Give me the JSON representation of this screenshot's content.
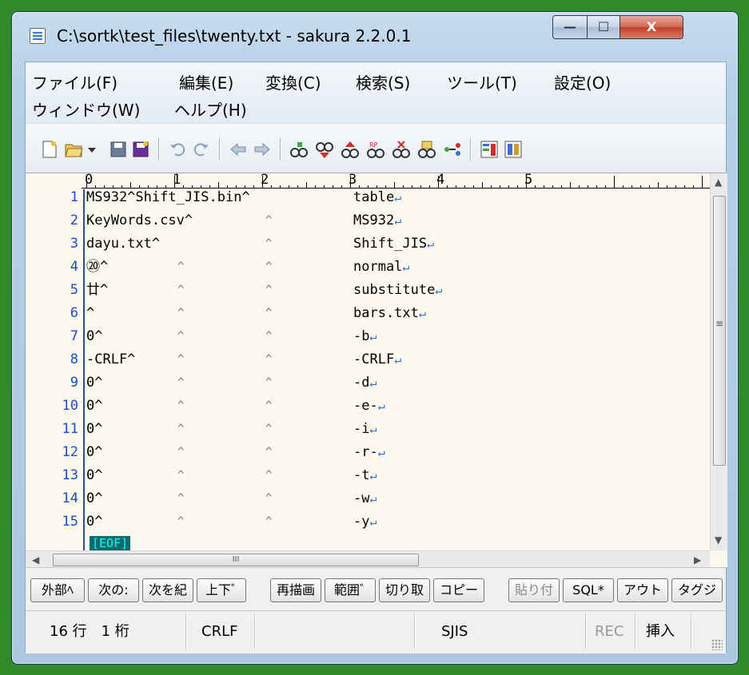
{
  "window": {
    "title": "C:\\sortk\\test_files\\twenty.txt - sakura 2.2.0.1",
    "min_glyph": "—",
    "max_glyph": "☐",
    "close_glyph": "X"
  },
  "menu": {
    "row1": [
      "ファイル(F)",
      "編集(E)",
      "変換(C)",
      "検索(S)",
      "ツール(T)",
      "設定(O)"
    ],
    "row2": [
      "ウィンドウ(W)",
      "ヘルプ(H)"
    ]
  },
  "toolbar": {
    "icons": [
      "new-file-icon",
      "open-file-icon",
      "dropdown-icon",
      "save-icon",
      "save-all-icon",
      "undo-icon",
      "redo-icon",
      "jump-back-icon",
      "jump-forward-icon",
      "find-icon",
      "find-next-icon",
      "find-prev-icon",
      "replace-icon",
      "replace-all-icon",
      "grep-icon",
      "tag-jump-icon",
      "outline-icon",
      "settings-icon"
    ]
  },
  "ruler": [
    "0",
    "1",
    "2",
    "3",
    "4",
    "5"
  ],
  "lines": [
    {
      "num": "1",
      "c1": "MS932^Shift_JIS.bin^",
      "t1": "",
      "t2": "",
      "c2": "table",
      "eol": "↵"
    },
    {
      "num": "2",
      "c1": "KeyWords.csv^",
      "t1": "",
      "t2": "^",
      "c2": "MS932",
      "eol": "↵"
    },
    {
      "num": "3",
      "c1": "dayu.txt^",
      "t1": "",
      "t2": "^",
      "c2": "Shift_JIS",
      "eol": "↵"
    },
    {
      "num": "4",
      "c1": "⑳^",
      "t1": "^",
      "t2": "^",
      "c2": "normal",
      "eol": "↵"
    },
    {
      "num": "5",
      "c1": "廿^",
      "t1": "^",
      "t2": "^",
      "c2": "substitute",
      "eol": "↵"
    },
    {
      "num": "6",
      "c1": "^",
      "t1": "^",
      "t2": "^",
      "c2": "bars.txt",
      "eol": "↵"
    },
    {
      "num": "7",
      "c1": "0^",
      "t1": "^",
      "t2": "^",
      "c2": "-b",
      "eol": "↵"
    },
    {
      "num": "8",
      "c1": "-CRLF^",
      "t1": "^",
      "t2": "^",
      "c2": "-CRLF",
      "eol": "↵"
    },
    {
      "num": "9",
      "c1": "0^",
      "t1": "^",
      "t2": "^",
      "c2": "-d",
      "eol": "↵"
    },
    {
      "num": "10",
      "c1": "0^",
      "t1": "^",
      "t2": "^",
      "c2": "-e-",
      "eol": "↵"
    },
    {
      "num": "11",
      "c1": "0^",
      "t1": "^",
      "t2": "^",
      "c2": "-i",
      "eol": "↵"
    },
    {
      "num": "12",
      "c1": "0^",
      "t1": "^",
      "t2": "^",
      "c2": "-r-",
      "eol": "↵"
    },
    {
      "num": "13",
      "c1": "0^",
      "t1": "^",
      "t2": "^",
      "c2": "-t",
      "eol": "↵"
    },
    {
      "num": "14",
      "c1": "0^",
      "t1": "^",
      "t2": "^",
      "c2": "-w",
      "eol": "↵"
    },
    {
      "num": "15",
      "c1": "0^",
      "t1": "^",
      "t2": "^",
      "c2": "-y",
      "eol": "↵"
    }
  ],
  "eof_marker": "[EOF]",
  "scroll": {
    "h_thumb_glyph": "III",
    "left": "◀",
    "right": "▶",
    "up": "▲",
    "down": "▼",
    "grip": "≡"
  },
  "func_keys": [
    {
      "label": "外部ﾍ",
      "disabled": false
    },
    {
      "label": "次の:",
      "disabled": false
    },
    {
      "label": "次を紀",
      "disabled": false
    },
    {
      "label": "上下ﾞ",
      "disabled": false
    },
    {
      "label": "再描画",
      "disabled": false
    },
    {
      "label": "範囲ﾞ",
      "disabled": false
    },
    {
      "label": "切り取",
      "disabled": false
    },
    {
      "label": "コピー",
      "disabled": false
    },
    {
      "label": "貼り付",
      "disabled": true
    },
    {
      "label": "SQL*",
      "disabled": false
    },
    {
      "label": "アウト",
      "disabled": false
    },
    {
      "label": "タグジ",
      "disabled": false
    }
  ],
  "status": {
    "row_col": "16 行　1 桁",
    "eol_mode": "CRLF",
    "encoding": "SJIS",
    "rec": "REC",
    "insert_mode": "挿入"
  }
}
